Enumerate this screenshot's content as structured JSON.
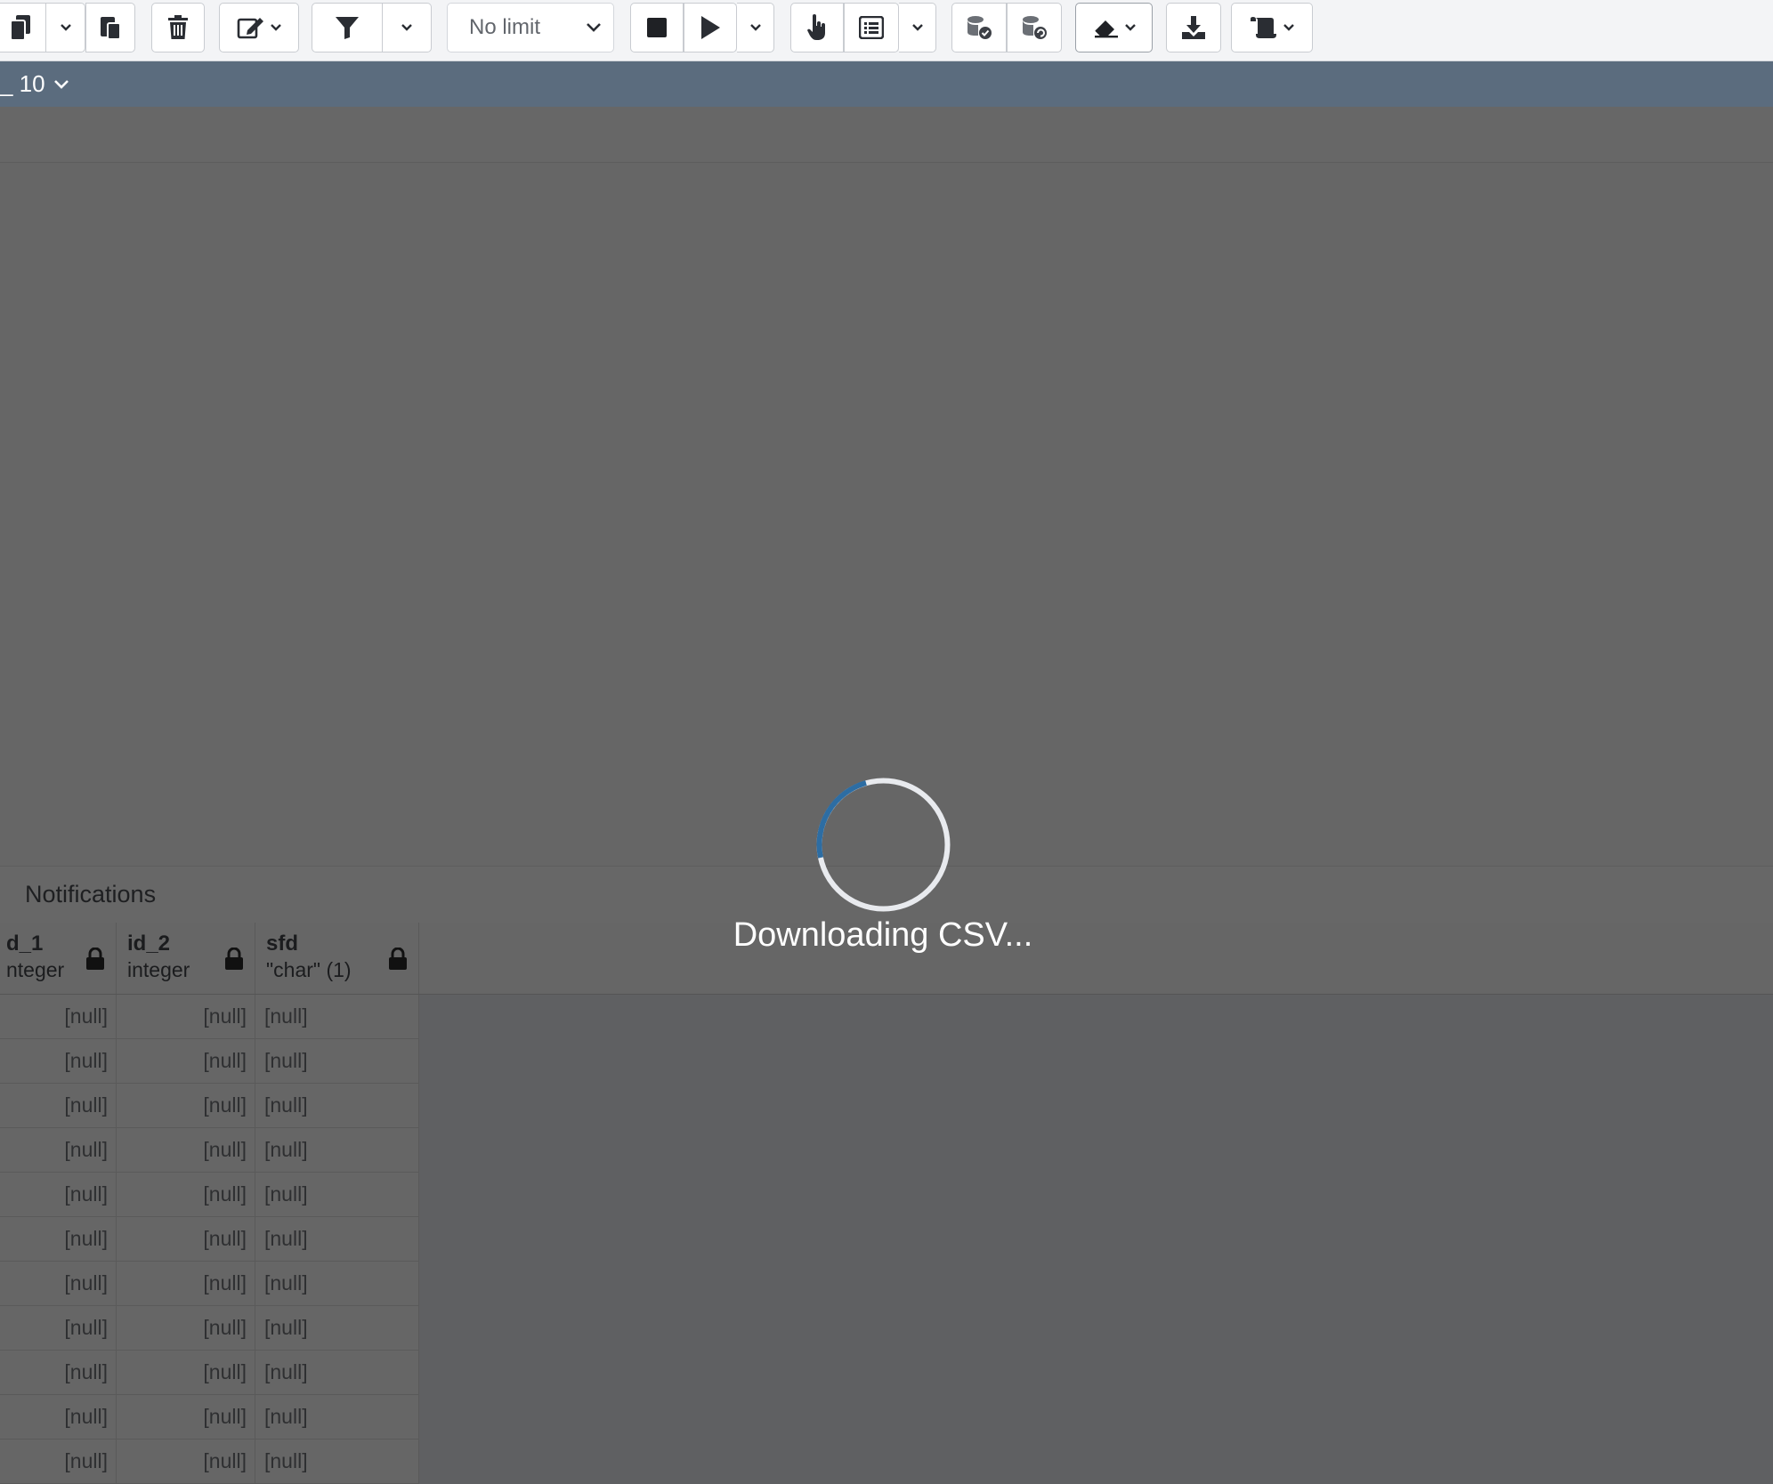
{
  "toolbar": {
    "limit_select": {
      "value": "No limit"
    }
  },
  "connection_bar": {
    "label": "_ 10"
  },
  "results": {
    "tabs": [
      {
        "label": "Notifications"
      }
    ],
    "columns": [
      {
        "name": "d_1",
        "type": "nteger"
      },
      {
        "name": "id_2",
        "type": "integer"
      },
      {
        "name": "sfd",
        "type": "\"char\" (1)"
      }
    ],
    "null_text": "[null]",
    "row_count_visible": 11
  },
  "overlay": {
    "message": "Downloading CSV...",
    "spinner_color": "#2d6da3"
  },
  "colors": {
    "toolbar_bg": "#f3f4f6",
    "connection_bar_bg": "#5b6c7e",
    "overlay_dim": "#666666"
  }
}
